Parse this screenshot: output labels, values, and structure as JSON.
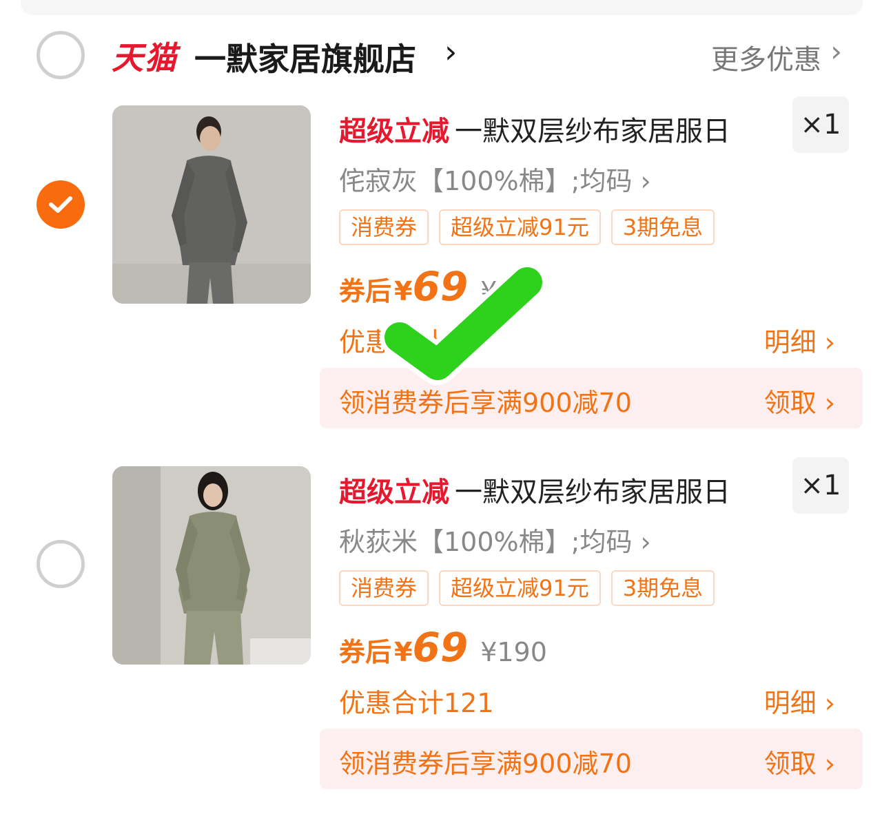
{
  "store": {
    "brand": "天猫",
    "name": "一默家居旗舰店",
    "chevron": "›",
    "more_offers": "更多优惠",
    "more_chevron": "›"
  },
  "items": [
    {
      "selected": true,
      "promo_tag": "超级立减",
      "name": "一默双层纱布家居服日",
      "quantity": "×1",
      "sku": "侘寂灰【100%棉】;均码 ›",
      "tags": [
        "消费券",
        "超级立减91元",
        "3期免息"
      ],
      "price_label": "券后",
      "currency": "¥",
      "price": "69",
      "original_price": "¥",
      "discount_text": "优惠合计",
      "detail_label": "明细 ›",
      "coupon_text": "领消费券后享满900减70",
      "coupon_claim": "领取 ›",
      "thumb_color": "#6f6f6d"
    },
    {
      "selected": false,
      "promo_tag": "超级立减",
      "name": "一默双层纱布家居服日",
      "quantity": "×1",
      "sku": "秋荻米【100%棉】;均码 ›",
      "tags": [
        "消费券",
        "超级立减91元",
        "3期免息"
      ],
      "price_label": "券后",
      "currency": "¥",
      "price": "69",
      "original_price": "¥190",
      "discount_text": "优惠合计121",
      "detail_label": "明细 ›",
      "coupon_text": "领消费券后享满900减70",
      "coupon_claim": "领取 ›",
      "thumb_color": "#8e9278"
    }
  ],
  "colors": {
    "accent_orange": "#f27315",
    "brand_red": "#e5182e",
    "checkbox_orange": "#f86b0f",
    "overlay_check_green": "#2ed11b"
  }
}
